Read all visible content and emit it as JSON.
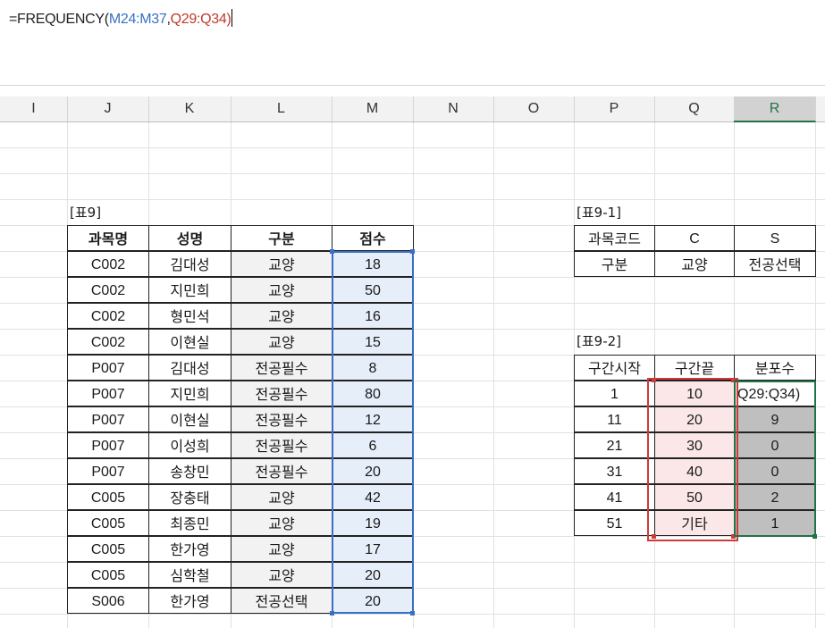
{
  "formula": {
    "prefix": "=FREQUENCY(",
    "arg1": "M24:M37",
    "comma": ",",
    "arg2": "Q29:Q34",
    "suffix": ")"
  },
  "columns": [
    "I",
    "J",
    "K",
    "L",
    "M",
    "N",
    "O",
    "P",
    "Q",
    "R"
  ],
  "active_column": "R",
  "table9": {
    "label": "[표9]",
    "headers": [
      "과목명",
      "성명",
      "구분",
      "점수"
    ],
    "rows": [
      [
        "C002",
        "김대성",
        "교양",
        "18"
      ],
      [
        "C002",
        "지민희",
        "교양",
        "50"
      ],
      [
        "C002",
        "형민석",
        "교양",
        "16"
      ],
      [
        "C002",
        "이현실",
        "교양",
        "15"
      ],
      [
        "P007",
        "김대성",
        "전공필수",
        "8"
      ],
      [
        "P007",
        "지민희",
        "전공필수",
        "80"
      ],
      [
        "P007",
        "이현실",
        "전공필수",
        "12"
      ],
      [
        "P007",
        "이성희",
        "전공필수",
        "6"
      ],
      [
        "P007",
        "송창민",
        "전공필수",
        "20"
      ],
      [
        "C005",
        "장충태",
        "교양",
        "42"
      ],
      [
        "C005",
        "최종민",
        "교양",
        "19"
      ],
      [
        "C005",
        "한가영",
        "교양",
        "17"
      ],
      [
        "C005",
        "심학철",
        "교양",
        "20"
      ],
      [
        "S006",
        "한가영",
        "전공선택",
        "20"
      ]
    ]
  },
  "table9_1": {
    "label": "[표9-1]",
    "rows": [
      [
        "과목코드",
        "C",
        "S"
      ],
      [
        "구분",
        "교양",
        "전공선택"
      ]
    ]
  },
  "table9_2": {
    "label": "[표9-2]",
    "headers": [
      "구간시작",
      "구간끝",
      "분포수"
    ],
    "rows": [
      [
        "1",
        "10",
        "Q29:Q34)"
      ],
      [
        "11",
        "20",
        "9"
      ],
      [
        "21",
        "30",
        "0"
      ],
      [
        "31",
        "40",
        "0"
      ],
      [
        "41",
        "50",
        "2"
      ],
      [
        "51",
        "기타",
        "1"
      ]
    ]
  },
  "colors": {
    "ref_blue": "#3a6fc4",
    "ref_red": "#c0392b",
    "excel_green": "#217346"
  }
}
